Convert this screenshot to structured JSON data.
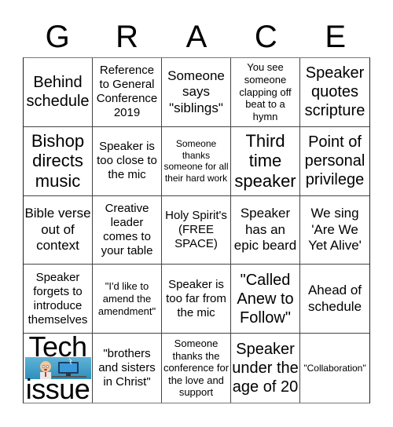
{
  "card": {
    "title_letters": [
      "G",
      "R",
      "A",
      "C",
      "E"
    ],
    "colors": {
      "background": "#ffffff",
      "grid_line": "#444444",
      "text": "#000000"
    },
    "cells": [
      {
        "text": "Behind schedule",
        "size": "lg"
      },
      {
        "text": "Reference to General Conference 2019",
        "size": "sm"
      },
      {
        "text": "Someone says \"siblings\"",
        "size": "md"
      },
      {
        "text": "You see someone clapping off beat to a hymn",
        "size": "xs"
      },
      {
        "text": "Speaker quotes scripture",
        "size": "lg"
      },
      {
        "text": "Bishop directs music",
        "size": "xl"
      },
      {
        "text": "Speaker is too close to the mic",
        "size": "sm"
      },
      {
        "text": "Someone thanks someone for all their hard work",
        "size": "xxs"
      },
      {
        "text": "Third time speaker",
        "size": "xl"
      },
      {
        "text": "Point of personal privilege",
        "size": "lg"
      },
      {
        "text": "Bible verse out of context",
        "size": "md"
      },
      {
        "text": "Creative leader comes to your table",
        "size": "sm"
      },
      {
        "text": "Holy Spirit's (FREE SPACE)",
        "size": "sm"
      },
      {
        "text": "Speaker has an epic beard",
        "size": "md"
      },
      {
        "text": "We sing 'Are We Yet Alive'",
        "size": "md"
      },
      {
        "text": "Speaker forgets to introduce themselves",
        "size": "sm"
      },
      {
        "text": "\"I'd like to amend the amendment\"",
        "size": "xs"
      },
      {
        "text": "Speaker is too far from the mic",
        "size": "sm"
      },
      {
        "text": "\"Called Anew to Follow\"",
        "size": "lg"
      },
      {
        "text": "Ahead of schedule",
        "size": "md"
      },
      {
        "text": "Tech issue",
        "size": "image",
        "icon": "tech-issue-illustration",
        "words": [
          "Tech",
          "issue"
        ]
      },
      {
        "text": "\"brothers and sisters in Christ\"",
        "size": "sm"
      },
      {
        "text": "Someone thanks the conference for the love and support",
        "size": "xs"
      },
      {
        "text": "Speaker under the age of 20",
        "size": "lg"
      },
      {
        "text": "\"Collaboration\"",
        "size": "xxs"
      }
    ]
  }
}
